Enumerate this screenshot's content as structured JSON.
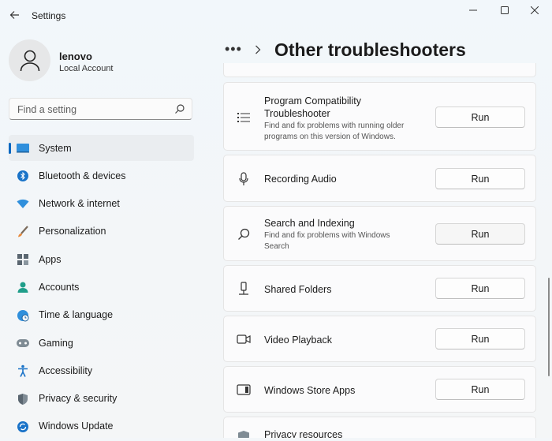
{
  "app": {
    "title": "Settings"
  },
  "profile": {
    "name": "lenovo",
    "account_type": "Local Account"
  },
  "search": {
    "placeholder": "Find a setting",
    "value": ""
  },
  "sidebar": {
    "items": [
      {
        "label": "System",
        "icon": "monitor-icon",
        "active": true
      },
      {
        "label": "Bluetooth & devices",
        "icon": "bluetooth-icon"
      },
      {
        "label": "Network & internet",
        "icon": "wifi-icon"
      },
      {
        "label": "Personalization",
        "icon": "brush-icon"
      },
      {
        "label": "Apps",
        "icon": "apps-icon"
      },
      {
        "label": "Accounts",
        "icon": "person-icon"
      },
      {
        "label": "Time & language",
        "icon": "globe-clock-icon"
      },
      {
        "label": "Gaming",
        "icon": "gamepad-icon"
      },
      {
        "label": "Accessibility",
        "icon": "accessibility-icon"
      },
      {
        "label": "Privacy & security",
        "icon": "shield-icon"
      },
      {
        "label": "Windows Update",
        "icon": "update-icon"
      }
    ]
  },
  "breadcrumb": {
    "ellipsis": "•••",
    "title": "Other troubleshooters"
  },
  "troubleshooters": [
    {
      "title": "Program Compatibility Troubleshooter",
      "description": "Find and fix problems with running older programs on this version of Windows.",
      "button": "Run",
      "icon": "list-icon"
    },
    {
      "title": "Recording Audio",
      "description": "",
      "button": "Run",
      "icon": "microphone-icon"
    },
    {
      "title": "Search and Indexing",
      "description": "Find and fix problems with Windows Search",
      "button": "Run",
      "icon": "search-icon"
    },
    {
      "title": "Shared Folders",
      "description": "",
      "button": "Run",
      "icon": "shared-folder-icon"
    },
    {
      "title": "Video Playback",
      "description": "",
      "button": "Run",
      "icon": "video-camera-icon"
    },
    {
      "title": "Windows Store Apps",
      "description": "",
      "button": "Run",
      "icon": "store-app-icon"
    },
    {
      "title": "Privacy resources",
      "description": "",
      "button": "",
      "icon": "shield-icon"
    }
  ],
  "colors": {
    "accent": "#0067c0",
    "background": "#f3f6f9",
    "card": "#fbfbfc"
  }
}
